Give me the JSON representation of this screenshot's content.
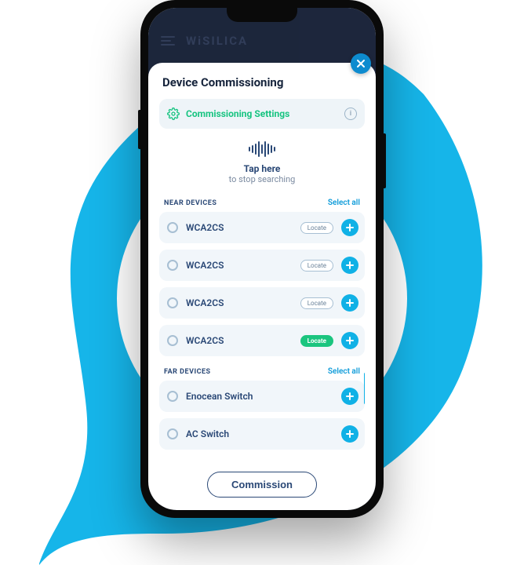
{
  "bg": {
    "brand": "WiSILICA"
  },
  "modal": {
    "title": "Device Commissioning",
    "settings_label": "Commissioning Settings",
    "tap_line1": "Tap here",
    "tap_line2": "to stop searching",
    "near_header": "NEAR DEVICES",
    "far_header": "FAR DEVICES",
    "select_all": "Select all",
    "locate_label": "Locate",
    "commission_label": "Commission",
    "near_devices": [
      {
        "name": "WCA2CS",
        "locate_active": false
      },
      {
        "name": "WCA2CS",
        "locate_active": false
      },
      {
        "name": "WCA2CS",
        "locate_active": false
      },
      {
        "name": "WCA2CS",
        "locate_active": true
      }
    ],
    "far_devices": [
      {
        "name": "Enocean Switch"
      },
      {
        "name": "AC Switch"
      }
    ]
  },
  "colors": {
    "blob": "#16b5e9",
    "accent_green": "#17c481",
    "accent_blue": "#10b1e6",
    "dark": "#2a4876"
  }
}
